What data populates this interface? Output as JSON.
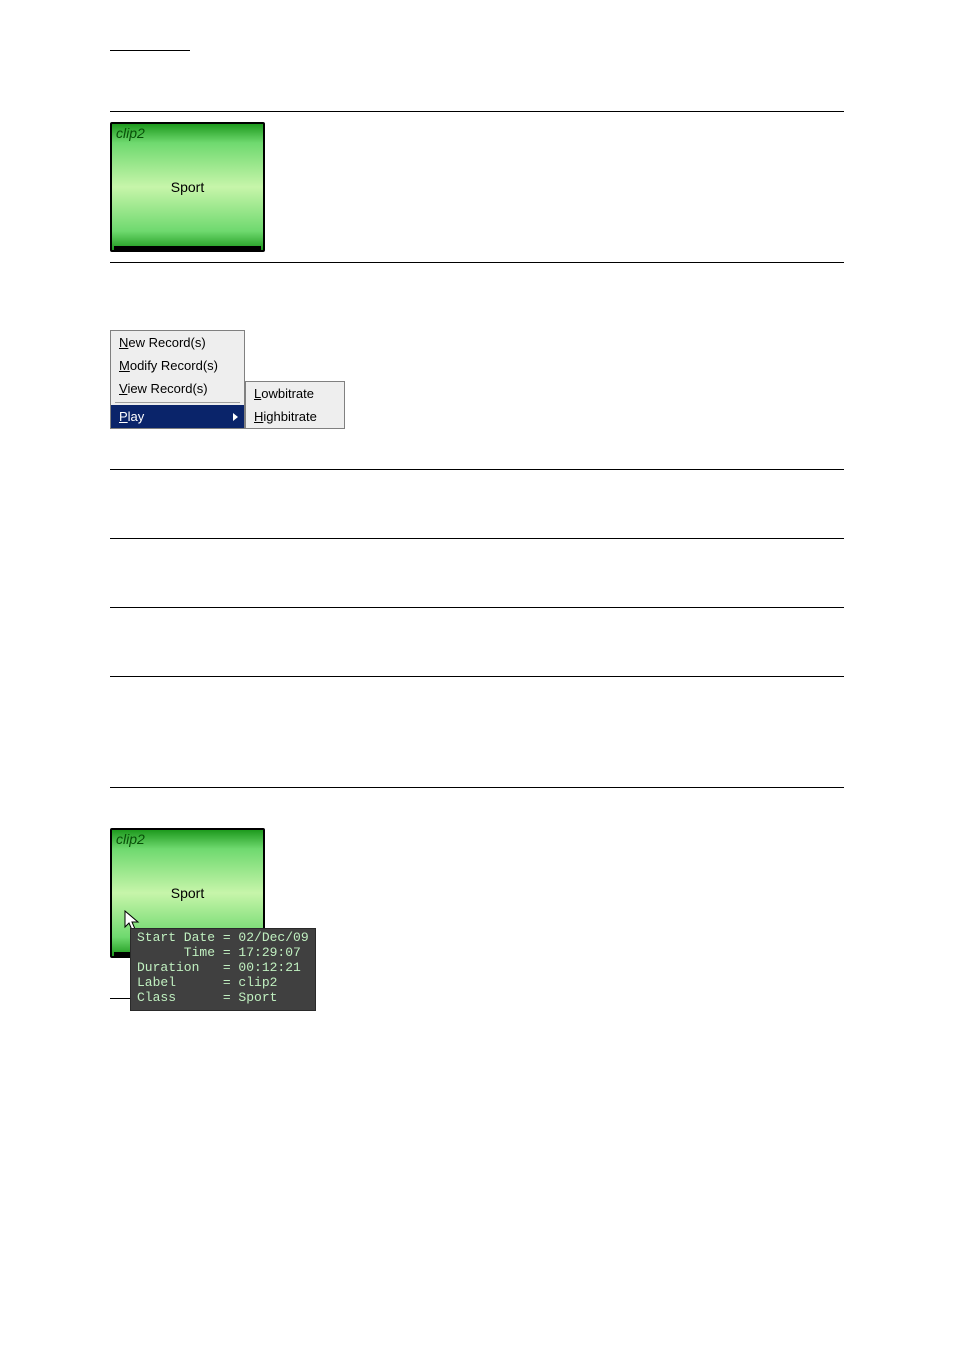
{
  "figure1": {
    "clip_title": "clip2",
    "clip_class_label": "Sport"
  },
  "context_menu": {
    "items": [
      "New Record(s)",
      "Modify Record(s)",
      "View Record(s)"
    ],
    "play_label": "Play",
    "submenu_items": [
      "Lowbitrate",
      "Highbitrate"
    ]
  },
  "figure2": {
    "clip_title": "clip2",
    "clip_class_label": "Sport",
    "tooltip": {
      "start_date": "Start Date = 02/Dec/09",
      "time": "      Time = 17:29:07",
      "duration": "Duration   = 00:12:21",
      "label": "Label      = clip2",
      "class": "Class      = Sport"
    }
  }
}
